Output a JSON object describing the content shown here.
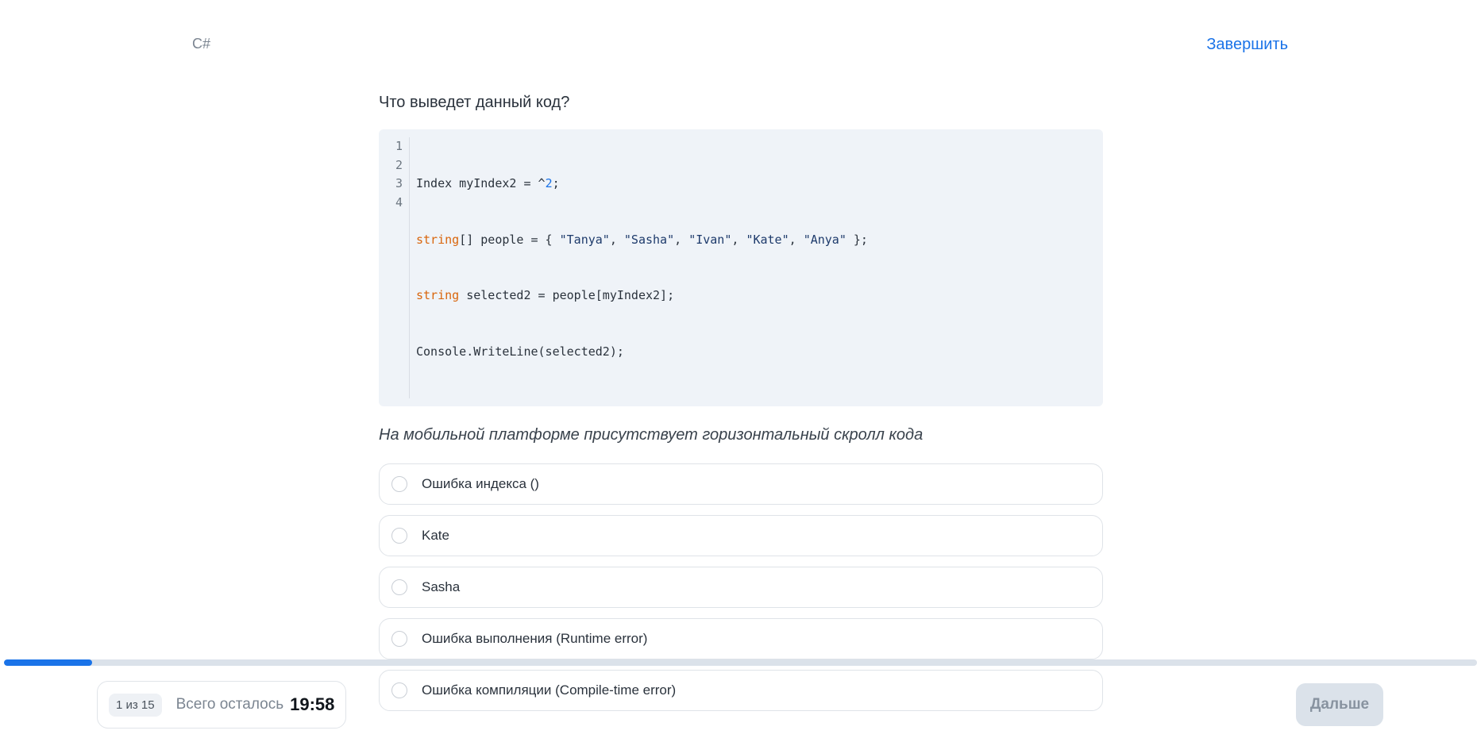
{
  "header": {
    "topic": "C#",
    "finish_label": "Завершить"
  },
  "question": {
    "text": "Что выведет данный код?",
    "note": "На мобильной платформе присутствует горизонтальный скролл кода"
  },
  "code": {
    "line_numbers": [
      "1",
      "2",
      "3",
      "4"
    ],
    "lines": [
      "Index myIndex2 = ^2;",
      "string[] people = { \"Tanya\", \"Sasha\", \"Ivan\", \"Kate\", \"Anya\" };",
      "string selected2 = people[myIndex2];",
      "Console.WriteLine(selected2);"
    ]
  },
  "options": [
    {
      "label": "Ошибка индекса ()"
    },
    {
      "label": "Kate"
    },
    {
      "label": "Sasha"
    },
    {
      "label": "Ошибка выполнения (Runtime error)"
    },
    {
      "label": "Ошибка компиляции (Compile-time error)"
    }
  ],
  "progress": {
    "fraction": 0.06
  },
  "footer": {
    "counter": "1 из 15",
    "remaining_label": "Всего осталось",
    "timer": "19:58",
    "next_label": "Дальше"
  },
  "colors": {
    "accent": "#1a73e8",
    "keyword": "#d9650c",
    "code_bg": "#eff3f8",
    "button_disabled_bg": "#dbe2ea"
  }
}
